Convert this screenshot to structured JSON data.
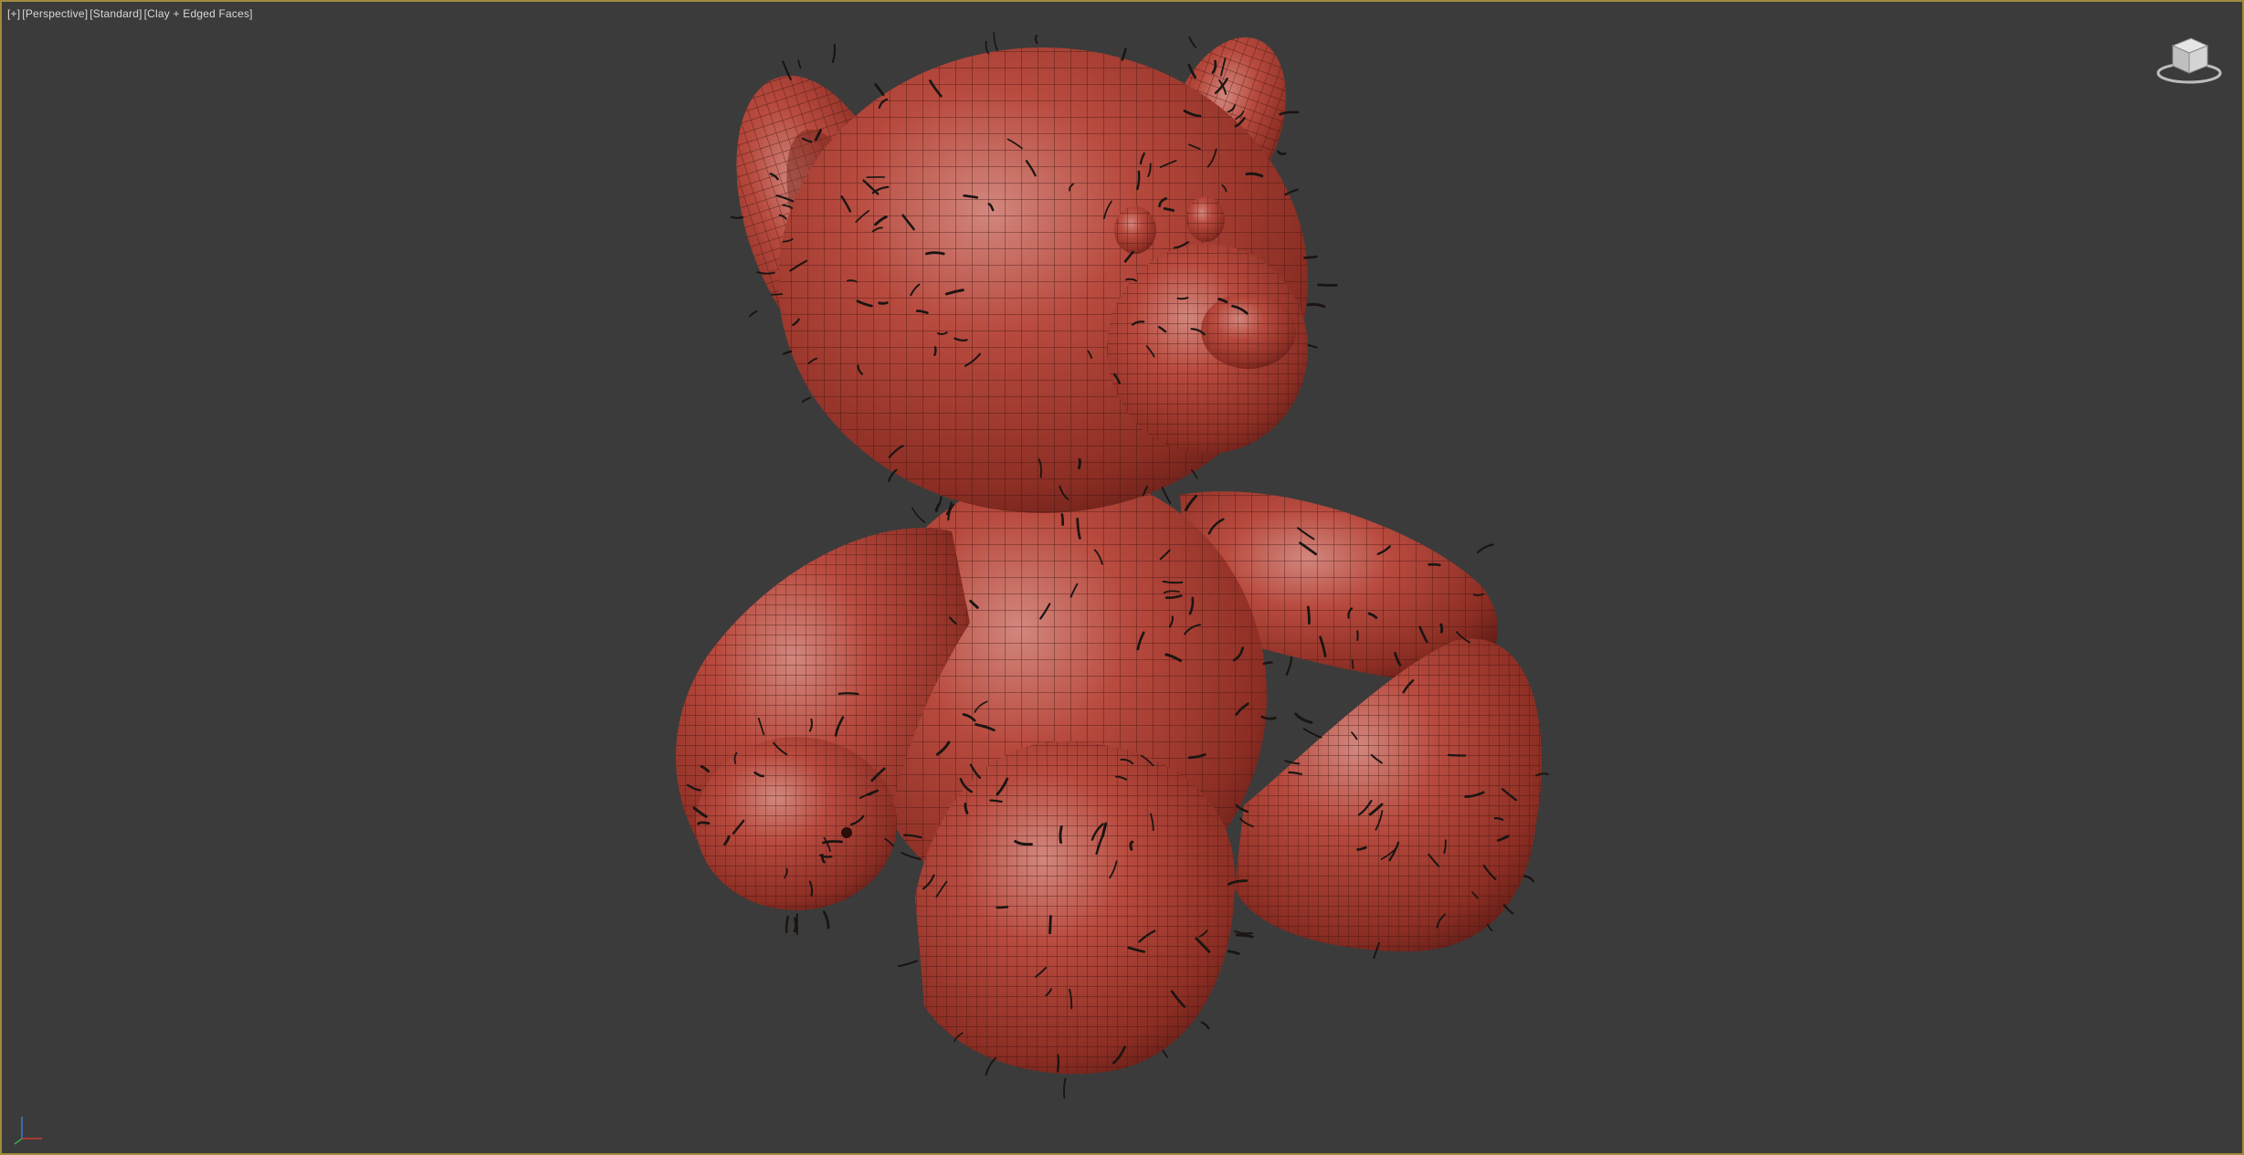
{
  "viewport": {
    "labels": {
      "plus": "[+]",
      "view": "[Perspective]",
      "shading_mode": "[Standard]",
      "display": "[Clay + Edged Faces]"
    },
    "frame_color": "#a08a3c",
    "background_color": "#3b3b3b"
  },
  "model": {
    "mesh_color": "#b4453a",
    "wire_color": "#3a120e",
    "hair_color": "#1a1512"
  },
  "icons": {
    "viewcube": "viewcube-icon",
    "axis": "axis-tripod-icon"
  }
}
